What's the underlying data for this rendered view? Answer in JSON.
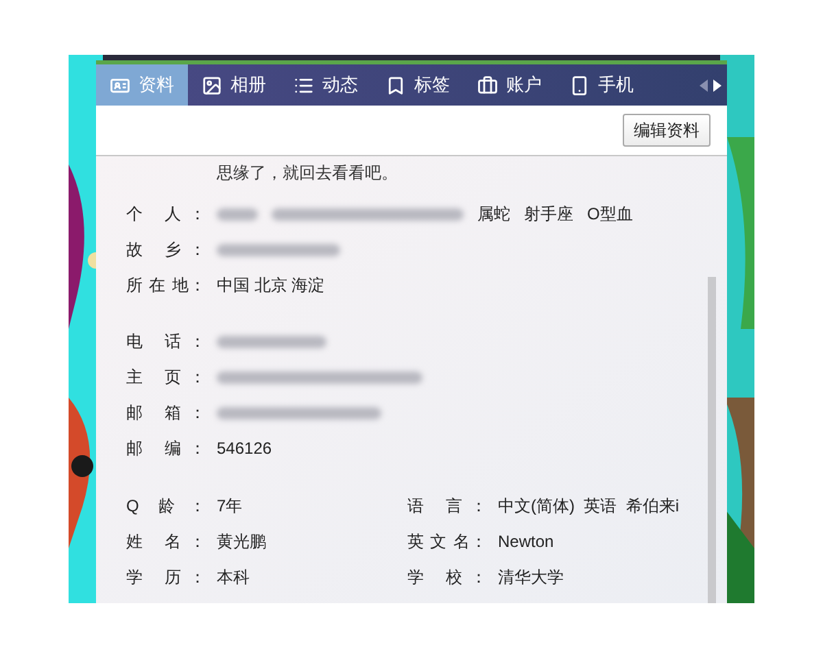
{
  "tabs": [
    {
      "label": "资料",
      "selected": true
    },
    {
      "label": "相册",
      "selected": false
    },
    {
      "label": "动态",
      "selected": false
    },
    {
      "label": "标签",
      "selected": false
    },
    {
      "label": "账户",
      "selected": false
    },
    {
      "label": "手机",
      "selected": false
    }
  ],
  "edit_button": "编辑资料",
  "intro_text": "思缘了，就回去看看吧。",
  "groups": [
    [
      {
        "label": "个 人：",
        "parts": [
          {
            "kind": "blurred"
          },
          {
            "kind": "blurred"
          },
          {
            "kind": "text",
            "text": "属蛇"
          },
          {
            "kind": "text",
            "text": "射手座"
          },
          {
            "kind": "text",
            "text": "O型血"
          }
        ]
      },
      {
        "label": "故 乡：",
        "parts": [
          {
            "kind": "blurred"
          }
        ]
      },
      {
        "label": "所 在 地：",
        "parts": [
          {
            "kind": "text",
            "text": "中国 北京 海淀"
          }
        ]
      }
    ],
    [
      {
        "label": "电 话：",
        "parts": [
          {
            "kind": "blurred"
          }
        ]
      },
      {
        "label": "主 页：",
        "parts": [
          {
            "kind": "blurred"
          }
        ]
      },
      {
        "label": "邮 箱：",
        "parts": [
          {
            "kind": "blurred"
          }
        ]
      },
      {
        "label": "邮 编：",
        "parts": [
          {
            "kind": "text",
            "text": "546126"
          }
        ]
      }
    ]
  ],
  "pairs": [
    {
      "left": {
        "label": "Q 龄：",
        "value": "7年"
      },
      "right": {
        "label": "语 言：",
        "value": "中文(简体)  英语  希伯来i"
      }
    },
    {
      "left": {
        "label": "姓 名：",
        "value": "黄光鹏"
      },
      "right": {
        "label": "英 文 名：",
        "value": "Newton"
      }
    },
    {
      "left": {
        "label": "学 历：",
        "value": "本科"
      },
      "right": {
        "label": "学 校：",
        "value": "清华大学"
      }
    }
  ]
}
